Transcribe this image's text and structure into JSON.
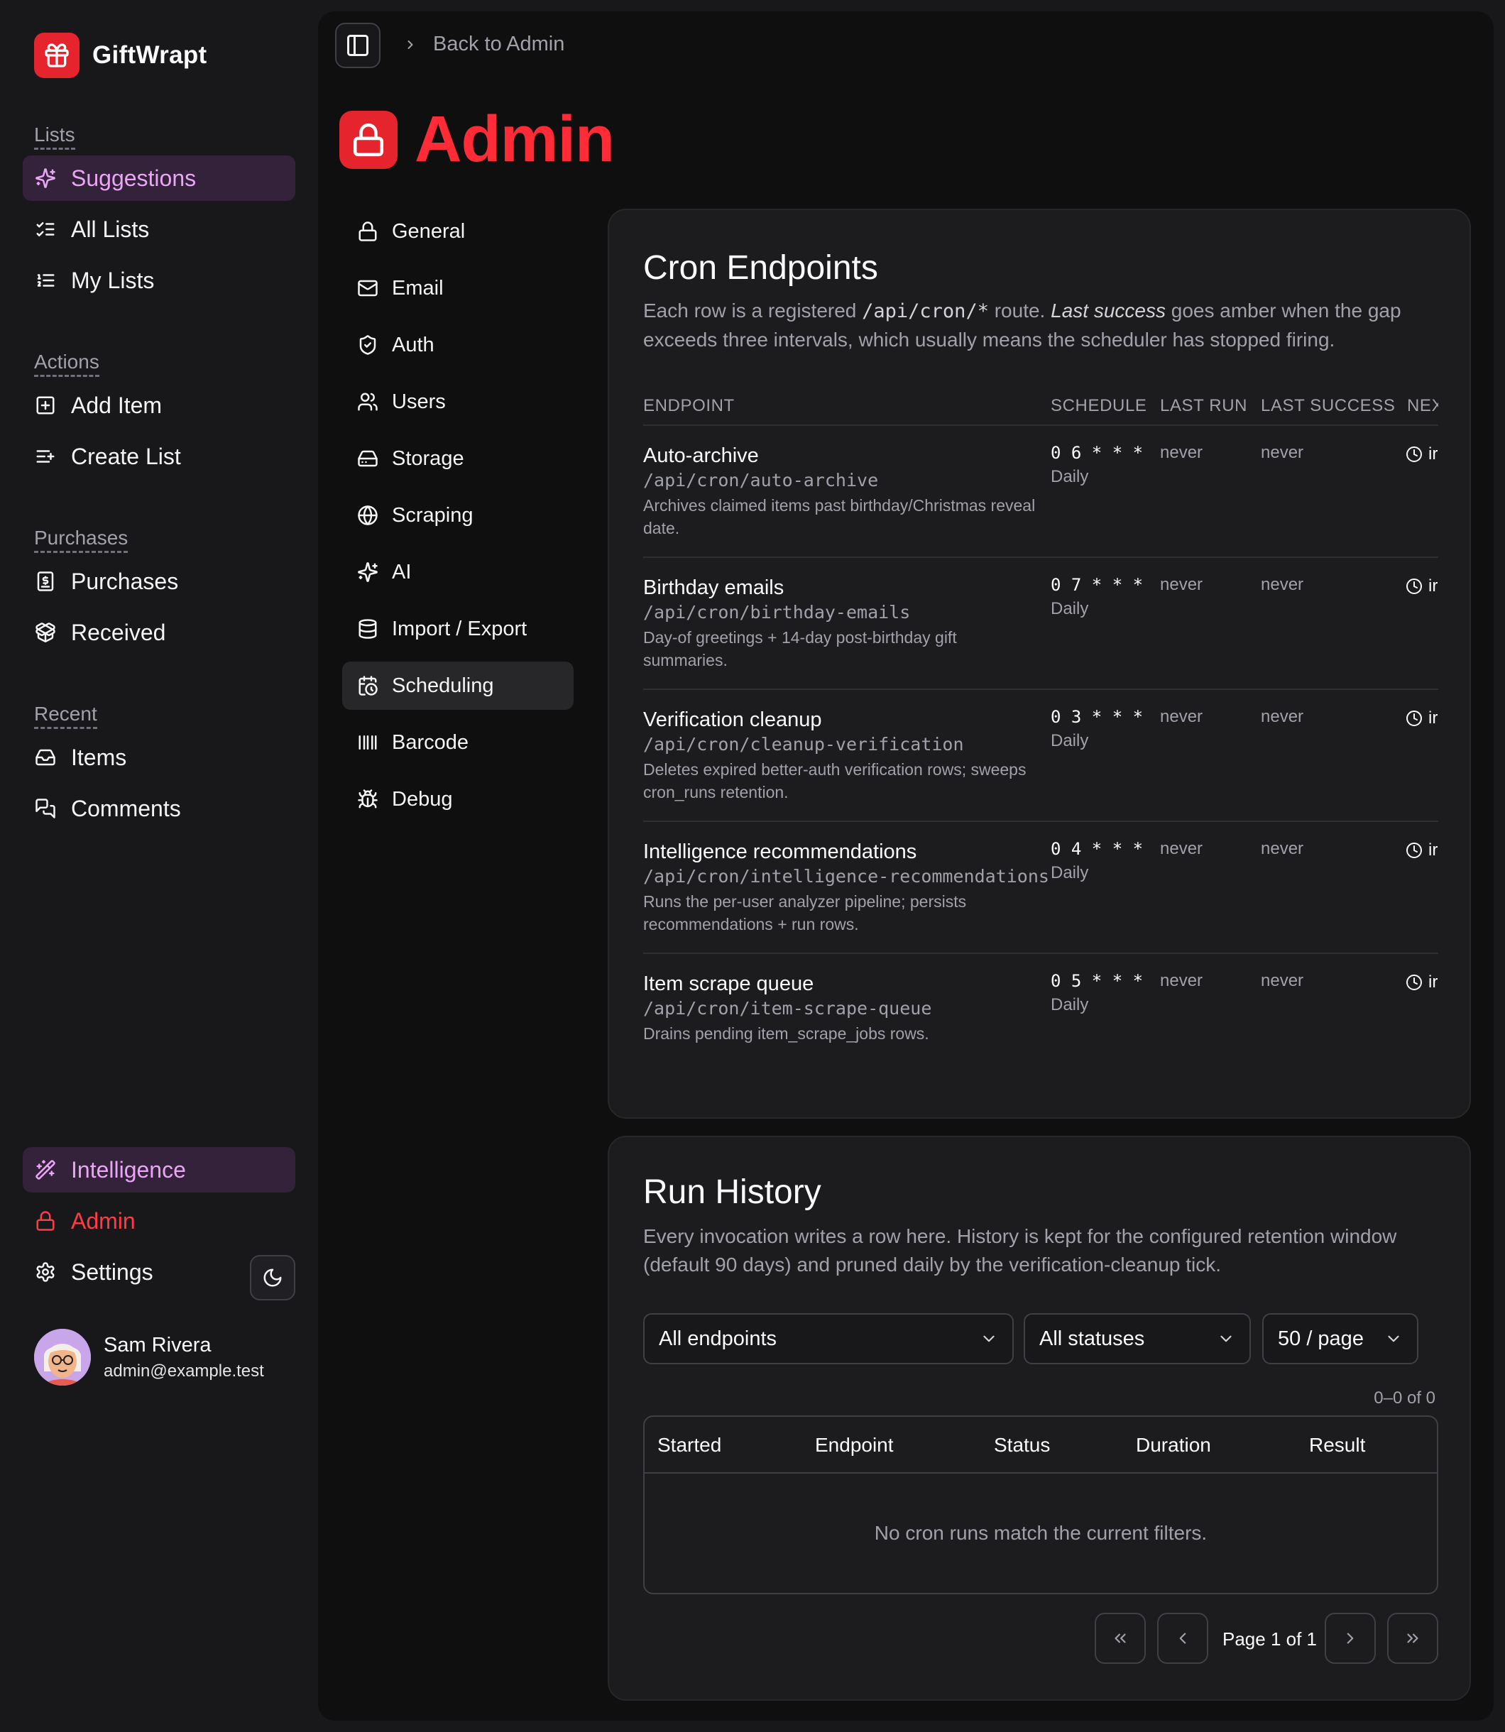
{
  "brand": {
    "name": "GiftWrapt"
  },
  "sidebar": {
    "groups": [
      {
        "label": "Lists",
        "items": [
          {
            "label": "Suggestions",
            "icon": "sparkles-icon",
            "active": true
          },
          {
            "label": "All Lists",
            "icon": "list-checks-icon"
          },
          {
            "label": "My Lists",
            "icon": "list-ordered-icon"
          }
        ]
      },
      {
        "label": "Actions",
        "items": [
          {
            "label": "Add Item",
            "icon": "square-plus-icon"
          },
          {
            "label": "Create List",
            "icon": "list-plus-icon"
          }
        ]
      },
      {
        "label": "Purchases",
        "items": [
          {
            "label": "Purchases",
            "icon": "receipt-icon"
          },
          {
            "label": "Received",
            "icon": "package-open-icon"
          }
        ]
      },
      {
        "label": "Recent",
        "items": [
          {
            "label": "Items",
            "icon": "inbox-icon"
          },
          {
            "label": "Comments",
            "icon": "messages-icon"
          }
        ]
      }
    ],
    "bottom": {
      "intelligence": "Intelligence",
      "admin": "Admin",
      "settings": "Settings"
    },
    "user": {
      "name": "Sam Rivera",
      "email": "admin@example.test"
    }
  },
  "header": {
    "breadcrumb": "Back to Admin",
    "title": "Admin"
  },
  "subnav": [
    {
      "label": "General",
      "icon": "lock-icon"
    },
    {
      "label": "Email",
      "icon": "mail-icon"
    },
    {
      "label": "Auth",
      "icon": "shield-icon"
    },
    {
      "label": "Users",
      "icon": "users-icon"
    },
    {
      "label": "Storage",
      "icon": "hard-drive-icon"
    },
    {
      "label": "Scraping",
      "icon": "globe-icon"
    },
    {
      "label": "AI",
      "icon": "sparkles-icon"
    },
    {
      "label": "Import / Export",
      "icon": "database-icon"
    },
    {
      "label": "Scheduling",
      "icon": "calendar-clock-icon",
      "active": true
    },
    {
      "label": "Barcode",
      "icon": "barcode-icon"
    },
    {
      "label": "Debug",
      "icon": "bug-icon"
    }
  ],
  "cron": {
    "title": "Cron Endpoints",
    "desc_1": "Each row is a registered ",
    "desc_code": "/api/cron/*",
    "desc_2": " route. ",
    "desc_em": "Last success",
    "desc_3": " goes amber when the gap exceeds three intervals, which usually means the scheduler has stopped firing.",
    "columns": {
      "endpoint": "ENDPOINT",
      "schedule": "SCHEDULE",
      "last_run": "LAST RUN",
      "last_success": "LAST SUCCESS",
      "next": "NEX"
    },
    "rows": [
      {
        "name": "Auto-archive",
        "path": "/api/cron/auto-archive",
        "desc": "Archives claimed items past birthday/Christmas reveal date.",
        "cron": "0 6 * * *",
        "freq": "Daily",
        "last_run": "never",
        "last_success": "never",
        "next": "ir"
      },
      {
        "name": "Birthday emails",
        "path": "/api/cron/birthday-emails",
        "desc": "Day-of greetings + 14-day post-birthday gift summaries.",
        "cron": "0 7 * * *",
        "freq": "Daily",
        "last_run": "never",
        "last_success": "never",
        "next": "ir"
      },
      {
        "name": "Verification cleanup",
        "path": "/api/cron/cleanup-verification",
        "desc": "Deletes expired better-auth verification rows; sweeps cron_runs retention.",
        "cron": "0 3 * * *",
        "freq": "Daily",
        "last_run": "never",
        "last_success": "never",
        "next": "ir"
      },
      {
        "name": "Intelligence recommendations",
        "path": "/api/cron/intelligence-recommendations",
        "desc": "Runs the per-user analyzer pipeline; persists recommendations + run rows.",
        "cron": "0 4 * * *",
        "freq": "Daily",
        "last_run": "never",
        "last_success": "never",
        "next": "ir"
      },
      {
        "name": "Item scrape queue",
        "path": "/api/cron/item-scrape-queue",
        "desc": "Drains pending item_scrape_jobs rows.",
        "cron": "0 5 * * *",
        "freq": "Daily",
        "last_run": "never",
        "last_success": "never",
        "next": "ir"
      }
    ]
  },
  "history": {
    "title": "Run History",
    "desc": "Every invocation writes a row here. History is kept for the configured retention window (default 90 days) and pruned daily by the verification-cleanup tick.",
    "filters": {
      "endpoint": "All endpoints",
      "status": "All statuses",
      "page_size": "50 / page"
    },
    "range": "0–0 of 0",
    "columns": {
      "started": "Started",
      "endpoint": "Endpoint",
      "status": "Status",
      "duration": "Duration",
      "result": "Result"
    },
    "empty": "No cron runs match the current filters.",
    "pagination": {
      "label": "Page 1 of 1"
    }
  }
}
